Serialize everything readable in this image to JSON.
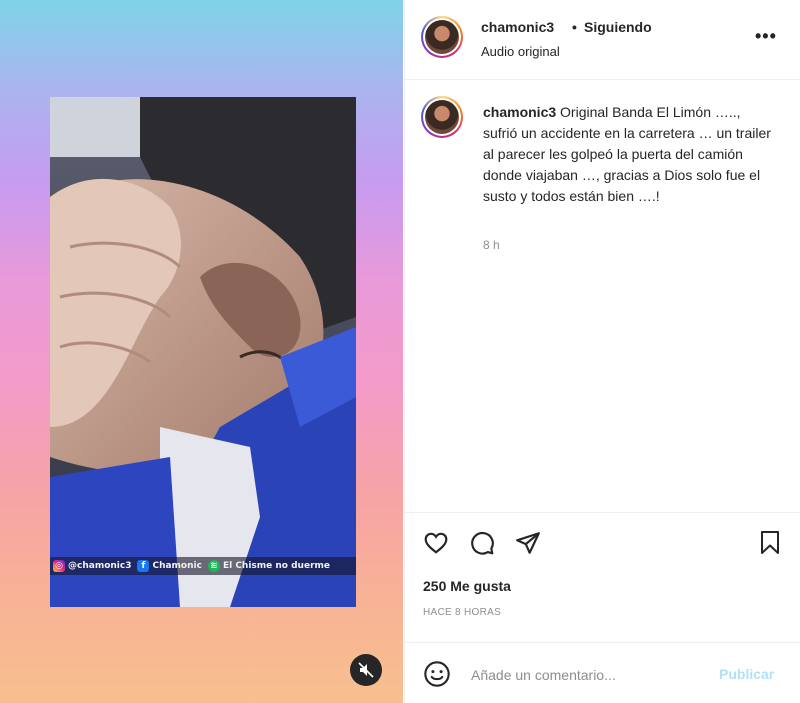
{
  "post": {
    "username": "chamonic3",
    "separator": "•",
    "follow_status": "Siguiendo",
    "audio_label": "Audio original",
    "more_glyph": "•••"
  },
  "caption": {
    "username": "chamonic3",
    "text": " Original Banda El Limón ….., sufrió un accidente en la carretera … un trailer al parecer les golpeó la puerta del camión donde viajaban …, gracias a Dios solo fue el susto y todos están bien ….!",
    "time": "8 h"
  },
  "media": {
    "watermark": [
      {
        "icon": "instagram-icon",
        "text": "@chamonic3"
      },
      {
        "icon": "facebook-icon",
        "text": "Chamonic"
      },
      {
        "icon": "spotify-icon",
        "text": "El Chisme no duerme"
      }
    ]
  },
  "engagement": {
    "likes": "250 Me gusta",
    "posted": "HACE 8 HORAS"
  },
  "comment": {
    "placeholder": "Añade un comentario...",
    "post_label": "Publicar"
  },
  "colors": {
    "text": "#262626",
    "muted": "#8e8e8e",
    "publish_disabled": "#b2dffc",
    "border": "#efefef"
  }
}
